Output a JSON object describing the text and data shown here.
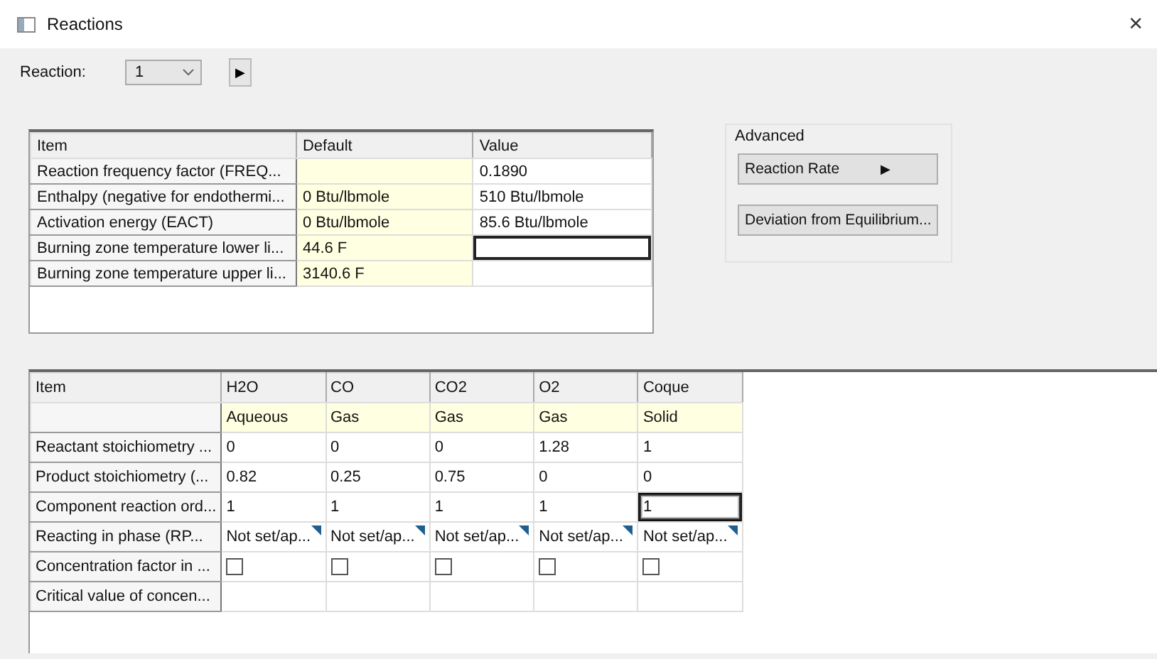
{
  "window": {
    "title": "Reactions",
    "close": "×"
  },
  "reaction": {
    "label": "Reaction:",
    "value": "1",
    "next": "▶"
  },
  "properties": {
    "columns": [
      "Item",
      "Default",
      "Value"
    ],
    "rows": [
      {
        "item": "Reaction frequency factor (FREQ...",
        "value": "0.1890",
        "selected": false
      },
      {
        "item": "Enthalpy (negative for endothermi...",
        "default": "0 Btu/lbmole",
        "value": "510 Btu/lbmole",
        "selected": false
      },
      {
        "item": "Activation energy (EACT)",
        "default": "0 Btu/lbmole",
        "value": "85.6 Btu/lbmole",
        "selected": false
      },
      {
        "item": "Burning zone temperature lower li...",
        "default": "44.6 F",
        "selected": true
      },
      {
        "item": "Burning zone temperature upper li...",
        "default": "3140.6 F",
        "selected": false
      }
    ]
  },
  "advanced": {
    "title": "Advanced",
    "buttons": [
      {
        "label": "Reaction Rate",
        "kind": "submenu",
        "arrow": "▶"
      },
      {
        "label": "Deviation from Equilibrium...",
        "kind": "plain"
      }
    ]
  },
  "components": {
    "item_header": "Item",
    "columns": [
      {
        "name": "H2O",
        "phase": "Aqueous"
      },
      {
        "name": "CO",
        "phase": "Gas"
      },
      {
        "name": "CO2",
        "phase": "Gas"
      },
      {
        "name": "O2",
        "phase": "Gas"
      },
      {
        "name": "Coque",
        "phase": "Solid"
      }
    ],
    "rows": [
      {
        "label": "Reactant stoichiometry ...",
        "kind": "text",
        "cells": [
          {
            "text": "0",
            "selected": false
          },
          {
            "text": "0",
            "selected": false
          },
          {
            "text": "0",
            "selected": false
          },
          {
            "text": "1.28",
            "selected": false
          },
          {
            "text": "1",
            "selected": false
          }
        ]
      },
      {
        "label": "Product stoichiometry (...",
        "kind": "text",
        "cells": [
          {
            "text": "0.82",
            "selected": false
          },
          {
            "text": "0.25",
            "selected": false
          },
          {
            "text": "0.75",
            "selected": false
          },
          {
            "text": "0",
            "selected": false
          },
          {
            "text": "0",
            "selected": false
          }
        ]
      },
      {
        "label": "Component reaction ord...",
        "kind": "text",
        "cells": [
          {
            "text": "1",
            "selected": false
          },
          {
            "text": "1",
            "selected": false
          },
          {
            "text": "1",
            "selected": false
          },
          {
            "text": "1",
            "selected": false
          },
          {
            "text": "1",
            "selected": true
          }
        ]
      },
      {
        "label": "Reacting in phase (RP...",
        "kind": "dropdown",
        "cells": [
          {
            "text": "Not set/ap..."
          },
          {
            "text": "Not set/ap..."
          },
          {
            "text": "Not set/ap..."
          },
          {
            "text": "Not set/ap..."
          },
          {
            "text": "Not set/ap..."
          }
        ]
      },
      {
        "label": "Concentration factor in ...",
        "kind": "checkbox",
        "cells": [
          {
            "checked": false
          },
          {
            "checked": false
          },
          {
            "checked": false
          },
          {
            "checked": false
          },
          {
            "checked": false
          }
        ]
      },
      {
        "label": "Critical value of concen...",
        "kind": "blank"
      }
    ]
  }
}
